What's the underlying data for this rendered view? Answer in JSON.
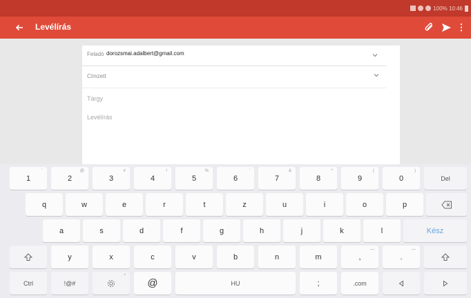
{
  "status_bar": {
    "text": "100% 10:46"
  },
  "app_bar": {
    "title": "Levélírás",
    "back_icon": "arrow-left-icon",
    "attach_icon": "paperclip-icon",
    "send_icon": "send-icon",
    "more_icon": "more-vertical-icon"
  },
  "compose": {
    "from_label": "Feladó",
    "from_value": "dorozsmai.adalbert@gmail.com",
    "to_label": "Címzett",
    "subject_placeholder": "Tárgy",
    "body_placeholder": "Levélírás"
  },
  "keyboard": {
    "row1": [
      {
        "label": "1",
        "sup": "`"
      },
      {
        "label": "2",
        "sup": "@"
      },
      {
        "label": "3",
        "sup": "#"
      },
      {
        "label": "4",
        "sup": "/"
      },
      {
        "label": "5",
        "sup": "%"
      },
      {
        "label": "6",
        "sup": "'"
      },
      {
        "label": "7",
        "sup": "&"
      },
      {
        "label": "8",
        "sup": "*"
      },
      {
        "label": "9",
        "sup": "("
      },
      {
        "label": "0",
        "sup": ")"
      }
    ],
    "del": "Del",
    "row2": [
      "q",
      "w",
      "e",
      "r",
      "t",
      "z",
      "u",
      "i",
      "o",
      "p"
    ],
    "row3": [
      "a",
      "s",
      "d",
      "f",
      "g",
      "h",
      "j",
      "k",
      "l"
    ],
    "done": "Kész",
    "row4": [
      "y",
      "x",
      "c",
      "v",
      "b",
      "n",
      "m"
    ],
    "comma": ",",
    "comma_sup": "—",
    "period": ".",
    "period_sup": "—",
    "ctrl": "Ctrl",
    "symbols": "!@#",
    "at": "@",
    "space": "HU",
    "semicolon": ";",
    "dotcom": ".com"
  },
  "colors": {
    "status": "#c0392b",
    "appbar": "#e04a39",
    "accent": "#6aa5e0"
  }
}
